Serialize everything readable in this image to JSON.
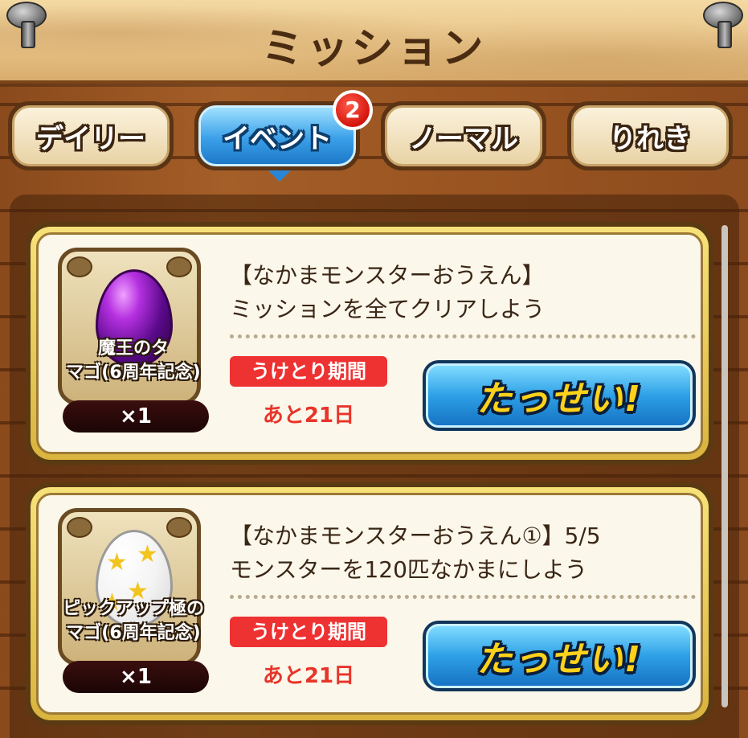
{
  "header": {
    "title": "ミッション"
  },
  "tabs": [
    {
      "label": "デイリー",
      "active": false
    },
    {
      "label": "イベント",
      "active": true,
      "badge": "2"
    },
    {
      "label": "ノーマル",
      "active": false
    },
    {
      "label": "りれき",
      "active": false
    }
  ],
  "missions": [
    {
      "reward_name_line1": "魔王のタ",
      "reward_name_line2": "マゴ(6周年記念)",
      "reward_qty": "×1",
      "title_line1": "【なかまモンスターおうえん】",
      "title_line2": "ミッションを全てクリアしよう",
      "period_label": "うけとり期間",
      "remaining": "あと21日",
      "button_label": "たっせい!"
    },
    {
      "reward_name_line1": "ピックアップ極のタ",
      "reward_name_line2": "マゴ(6周年記念)",
      "reward_qty": "×1",
      "title_line1": "【なかまモンスターおうえん①】5/5",
      "title_line2": "モンスターを120匹なかまにしよう",
      "period_label": "うけとり期間",
      "remaining": "あと21日",
      "button_label": "たっせい!"
    }
  ],
  "icons": {
    "egg1": "dark-purple-egg-icon",
    "egg2": "star-egg-icon",
    "pins": "pushpin-icon"
  },
  "colors": {
    "accent_blue": "#2ea0e6",
    "badge_red": "#d4150c",
    "period_red": "#ee3131",
    "button_text_yellow": "#ffd21a"
  }
}
